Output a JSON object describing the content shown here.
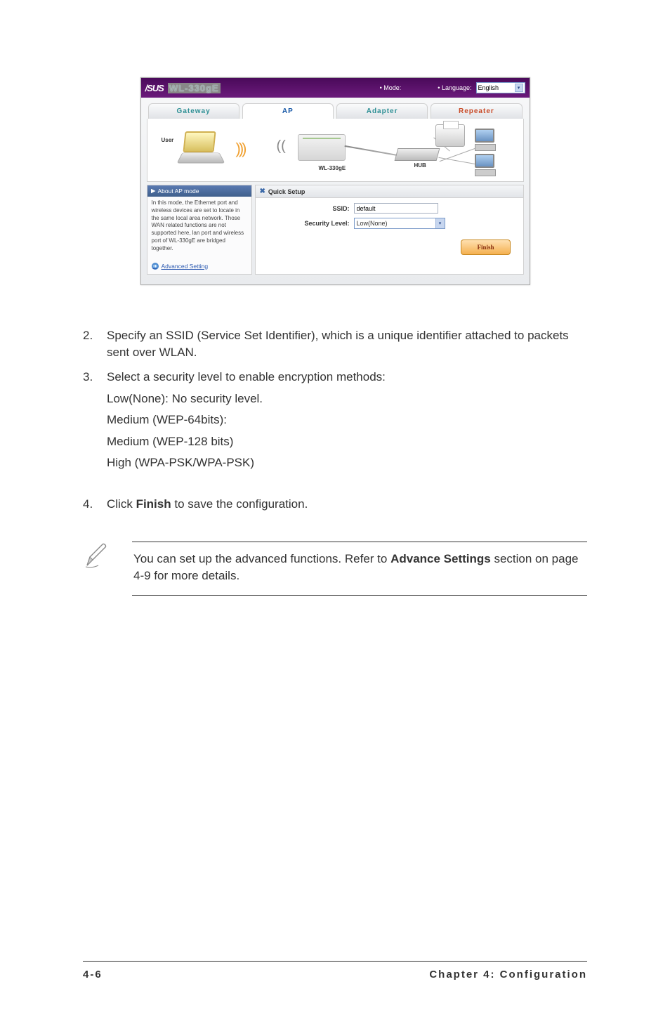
{
  "router_ui": {
    "brand": "/SUS",
    "model": "WL-330gE",
    "mode_label": "• Mode:",
    "language_label": "• Language:",
    "language_value": "English",
    "tabs": {
      "gateway": "Gateway",
      "ap": "AP",
      "adapter": "Adapter",
      "repeater": "Repeater"
    },
    "diagram": {
      "user": "User",
      "device": "WL-330gE",
      "hub": "HUB"
    },
    "sidebar": {
      "title": "About AP mode",
      "text": "In this mode, the Ethernet port and wireless devices are set to locate in the same local area network. Those WAN related functions are not supported here, lan port and wireless port of WL-330gE are bridged together.",
      "link": "Advanced Setting"
    },
    "main": {
      "title": "Quick Setup",
      "ssid_label": "SSID:",
      "ssid_value": "default",
      "seclevel_label": "Security Level:",
      "seclevel_value": "Low(None)",
      "finish": "Finish"
    }
  },
  "doc": {
    "step2": {
      "num": "2.",
      "text": "Specify an SSID (Service Set Identifier), which is a unique identifier attached to packets sent over WLAN."
    },
    "step3": {
      "num": "3.",
      "intro": "Select a security level to enable encryption methods:",
      "lines": [
        "Low(None): No security level.",
        "Medium (WEP-64bits):",
        "Medium (WEP-128 bits)",
        "High (WPA-PSK/WPA-PSK)"
      ]
    },
    "step4": {
      "num": "4.",
      "pre": "Click ",
      "bold": "Finish",
      "post": " to save the configuration."
    },
    "note": {
      "pre": "You can set up the advanced functions. Refer to ",
      "bold": "Advance Settings",
      "post": " section on page 4-9 for more details."
    },
    "footer": {
      "page": "4-6",
      "chapter": "Chapter 4: Configuration"
    }
  }
}
